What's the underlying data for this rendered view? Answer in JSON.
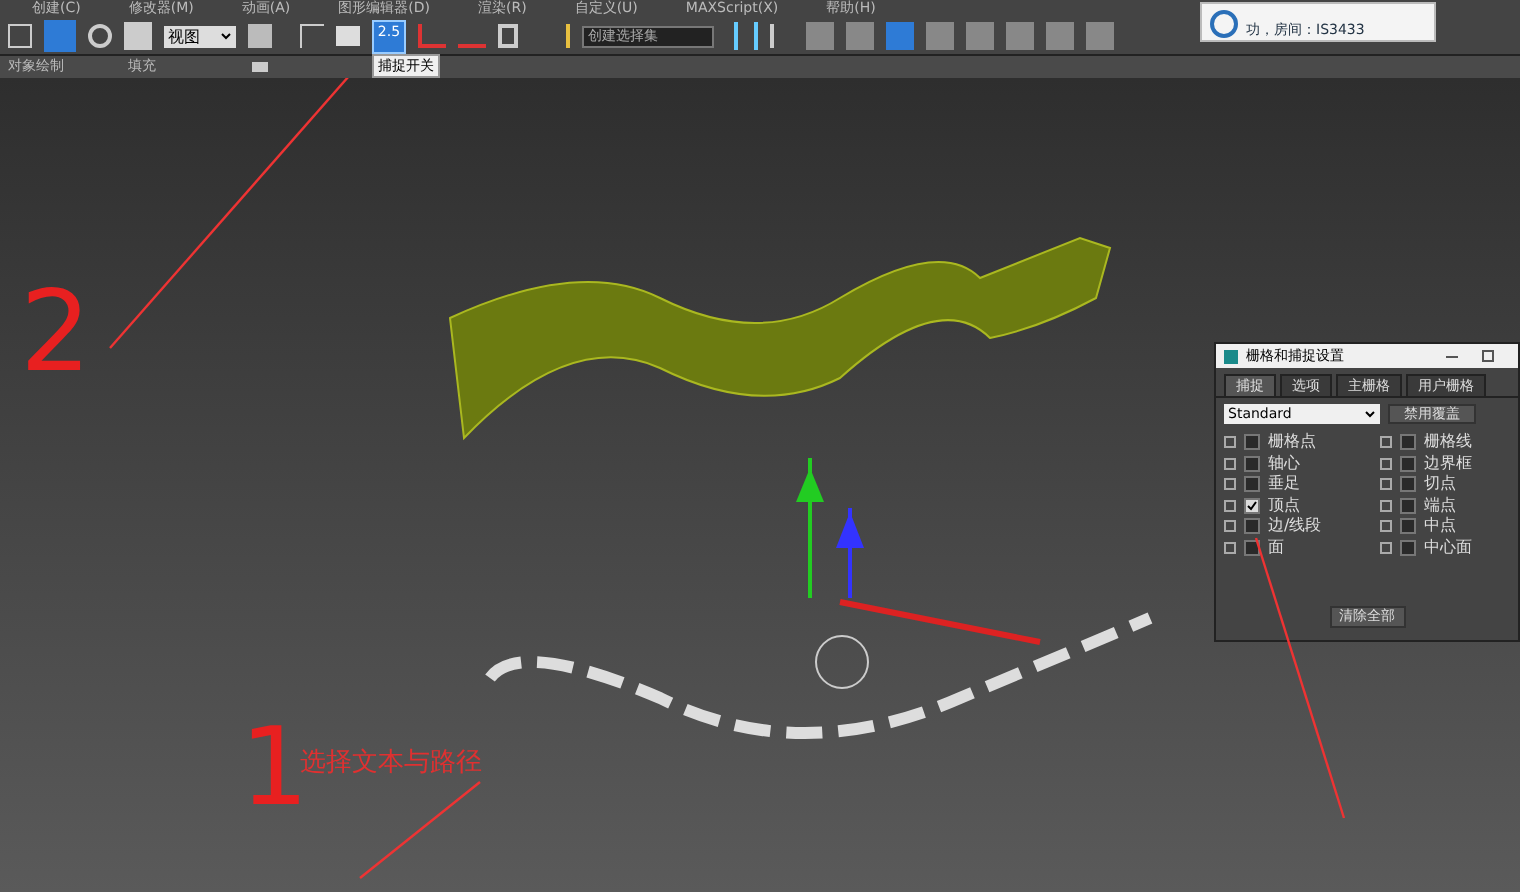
{
  "menu": [
    "创建(C)",
    "修改器(M)",
    "动画(A)",
    "图形编辑器(D)",
    "渲染(R)",
    "自定义(U)",
    "MAXScript(X)",
    "帮助(H)"
  ],
  "toolbar": {
    "view_dropdown": "视图",
    "snap_toggle": {
      "label": "2.5",
      "selected": true
    },
    "tooltip": "捕捉开关",
    "selection_set": {
      "placeholder": "创建选择集"
    }
  },
  "ribbon": [
    "对象绘制",
    "填充"
  ],
  "popup": {
    "text": "功，房间：IS3433"
  },
  "dialog": {
    "title": "栅格和捕捉设置",
    "tabs": [
      {
        "label": "捕捉",
        "selected": true
      },
      {
        "label": "选项",
        "selected": false
      },
      {
        "label": "主栅格",
        "selected": false
      },
      {
        "label": "用户栅格",
        "selected": false
      }
    ],
    "preset": "Standard",
    "override_button": "禁用覆盖",
    "options_left": [
      {
        "label": "栅格点",
        "checked": false
      },
      {
        "label": "轴心",
        "checked": false
      },
      {
        "label": "垂足",
        "checked": false
      },
      {
        "label": "顶点",
        "checked": true
      },
      {
        "label": "边/线段",
        "checked": false
      },
      {
        "label": "面",
        "checked": false
      }
    ],
    "options_right": [
      {
        "label": "栅格线",
        "checked": false
      },
      {
        "label": "边界框",
        "checked": false
      },
      {
        "label": "切点",
        "checked": false
      },
      {
        "label": "端点",
        "checked": false
      },
      {
        "label": "中点",
        "checked": false
      },
      {
        "label": "中心面",
        "checked": false
      }
    ],
    "clear_button": "清除全部"
  },
  "annotations": [
    {
      "text": "2"
    },
    {
      "text": "1"
    },
    {
      "text": "选择文本与路径"
    }
  ]
}
